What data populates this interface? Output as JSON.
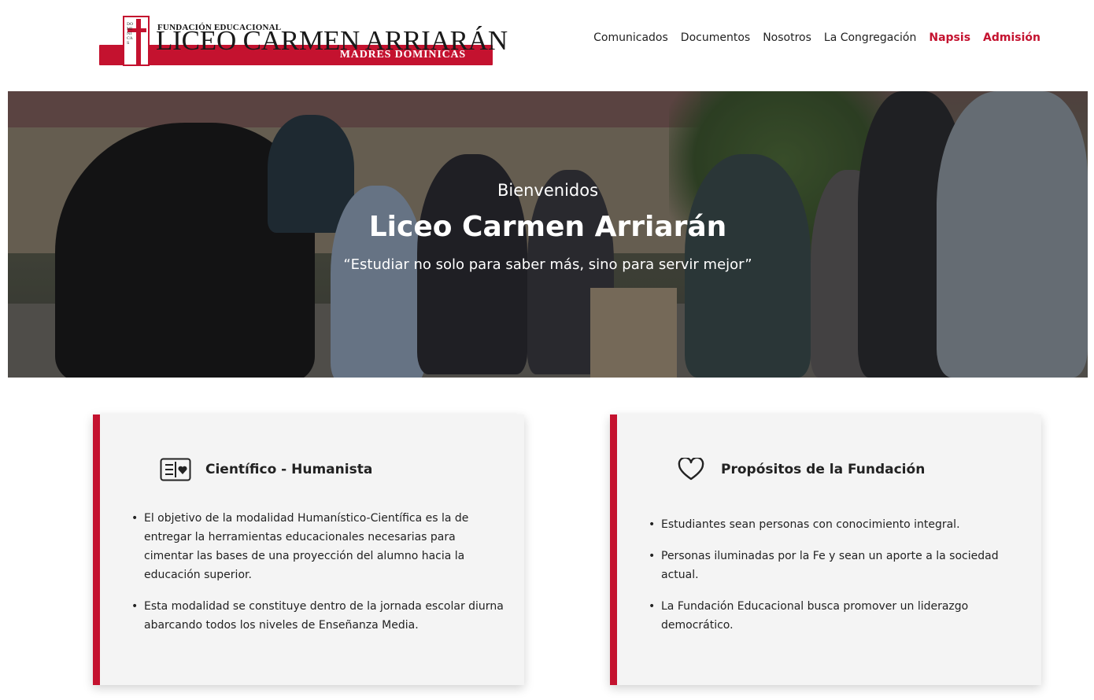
{
  "logo": {
    "small_text": "FUNDACIÓN EDUCACIONAL",
    "main_text": "LICEO CARMEN ARRIARÁN",
    "sub_text": "MADRES DOMINICAS",
    "side_text": "DOMINICAS"
  },
  "nav": {
    "items": [
      {
        "label": "Comunicados"
      },
      {
        "label": "Documentos"
      },
      {
        "label": "Nosotros"
      },
      {
        "label": "La Congregación"
      },
      {
        "label": "Napsis"
      },
      {
        "label": "Admisión"
      }
    ],
    "accent_color": "#c4122f"
  },
  "hero": {
    "kicker": "Bienvenidos",
    "title": "Liceo Carmen Arriarán",
    "quote": "“Estudiar no solo para saber más, sino para servir mejor”"
  },
  "cards": [
    {
      "icon": "id-card-heart-icon",
      "title": "Científico - Humanista",
      "items": [
        "El objetivo de la modalidad Humanístico-Científica es la de entregar la herramientas educacionales necesarias para cimentar las bases de una proyección del alumno hacia la educación superior.",
        "Esta modalidad se constituye dentro de la jornada escolar diurna abarcando todos los niveles de Enseñanza Media."
      ]
    },
    {
      "icon": "heart-icon",
      "title": "Propósitos de la Fundación",
      "items": [
        "Estudiantes sean personas con conocimiento integral.",
        "Personas iluminadas por la Fe y sean un aporte a la sociedad actual.",
        "La Fundación Educacional busca promover un liderazgo democrático."
      ]
    }
  ]
}
